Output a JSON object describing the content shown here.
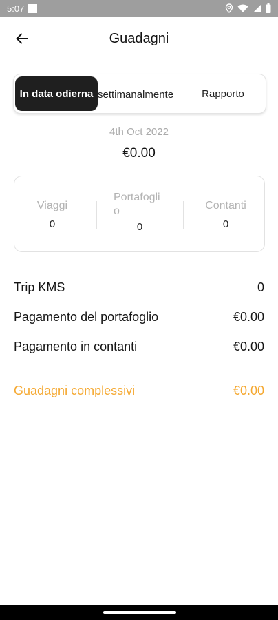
{
  "status_bar": {
    "time": "5:07",
    "icons": [
      "image-icon",
      "location-icon",
      "wifi-icon",
      "signal-icon",
      "battery-icon"
    ]
  },
  "header": {
    "title": "Guadagni",
    "back_icon": "arrow-left-icon"
  },
  "tabs": [
    {
      "label": "In data odierna",
      "active": true
    },
    {
      "label": "settimanalmente",
      "active": false
    },
    {
      "label": "Rapporto",
      "active": false
    }
  ],
  "summary": {
    "date": "4th Oct 2022",
    "total": "€0.00"
  },
  "stats": [
    {
      "label": "Viaggi",
      "value": "0"
    },
    {
      "label": "Portafoglio",
      "value": "0"
    },
    {
      "label": "Contanti",
      "value": "0"
    }
  ],
  "details": [
    {
      "label": "Trip KMS",
      "value": "0"
    },
    {
      "label": "Pagamento del portafoglio",
      "value": "€0.00"
    },
    {
      "label": "Pagamento in contanti",
      "value": "€0.00"
    }
  ],
  "overall": {
    "label": "Guadagni complessivi",
    "value": "€0.00"
  },
  "colors": {
    "accent": "#f5a830",
    "active_tab": "#1f1f1f",
    "status_bar": "#9e9e9e"
  }
}
